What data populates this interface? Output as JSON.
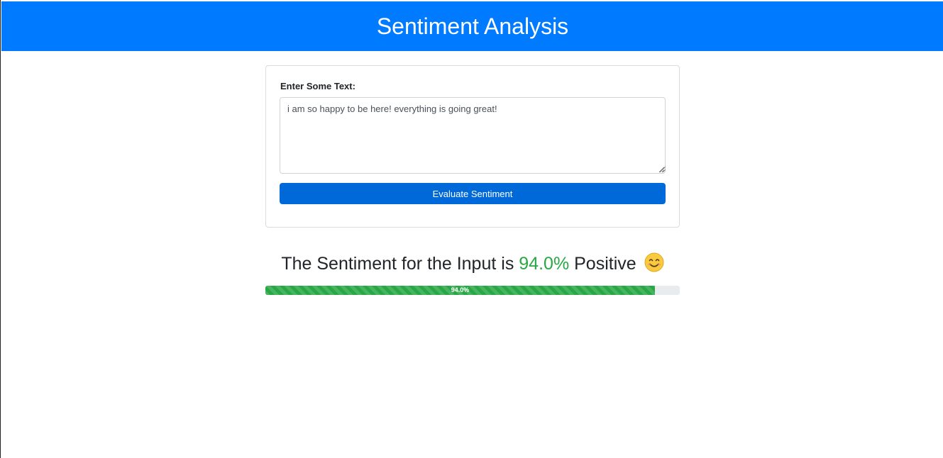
{
  "header": {
    "title": "Sentiment Analysis"
  },
  "form": {
    "label": "Enter Some Text:",
    "text_value": "i am so happy to be here! everything is going great!",
    "button_label": "Evaluate Sentiment"
  },
  "result": {
    "prefix": "The Sentiment for the Input is",
    "percent": "94.0%",
    "polarity": "Positive",
    "emoji": "smiling-face-icon"
  },
  "progress": {
    "fraction": 0.94,
    "label": "94.0%"
  },
  "colors": {
    "header": "#007bff",
    "button": "#0069d9",
    "positive": "#28a745"
  }
}
